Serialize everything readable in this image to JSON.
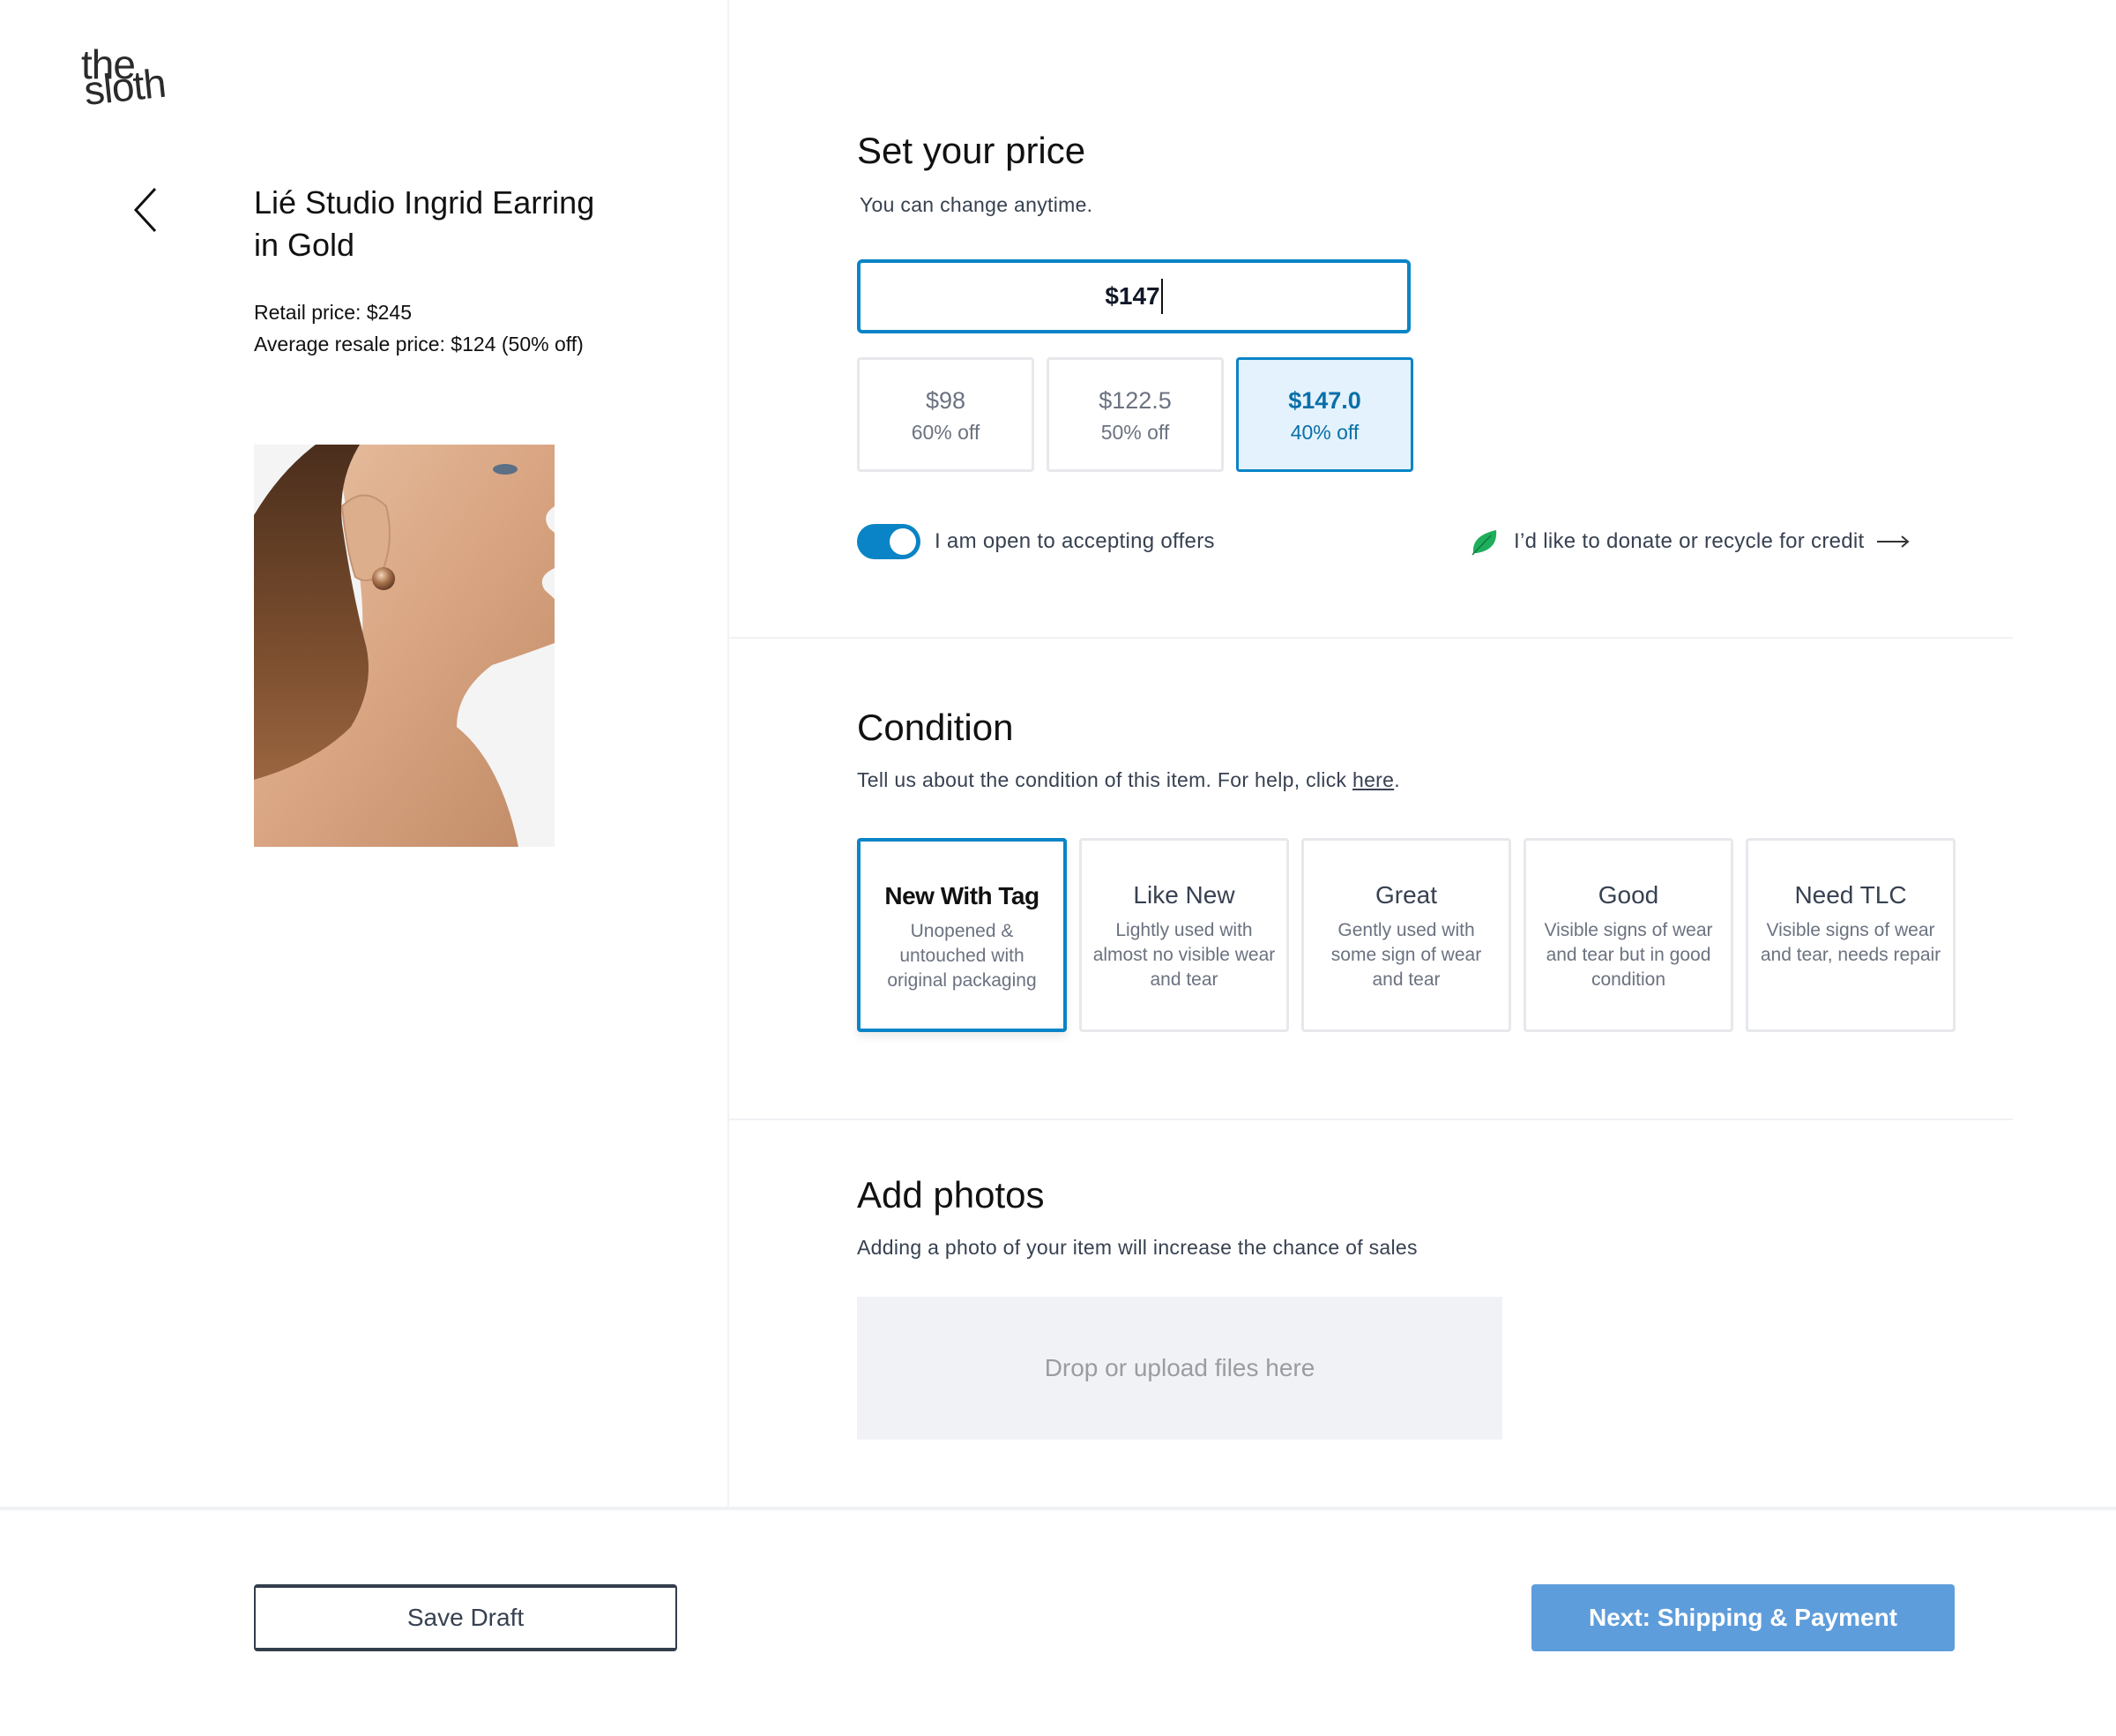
{
  "brand": {
    "logo_line1": "the",
    "logo_line2": "sloth"
  },
  "product": {
    "title": "Lié Studio Ingrid Earring in Gold",
    "retail_price": "Retail price: $245",
    "avg_resale_price": "Average resale price: $124 (50% off)",
    "image_alt": "Model wearing gold earring"
  },
  "price_section": {
    "title": "Set your price",
    "subtitle": "You can change anytime.",
    "input_value": "$147",
    "options": [
      {
        "value": "$98",
        "discount": "60% off",
        "selected": false
      },
      {
        "value": "$122.5",
        "discount": "50% off",
        "selected": false
      },
      {
        "value": "$147.0",
        "discount": "40% off",
        "selected": true
      }
    ],
    "offers_toggle": {
      "label": "I am open to accepting offers",
      "on": true
    },
    "donate_link": "I’d like to donate or recycle for credit"
  },
  "condition_section": {
    "title": "Condition",
    "subtitle_prefix": "Tell us about the condition of this item. For help, click ",
    "help_link": "here",
    "subtitle_suffix": ".",
    "options": [
      {
        "title": "New With Tag",
        "description": "Unopened & untouched with original packaging",
        "selected": true
      },
      {
        "title": "Like New",
        "description": "Lightly used with almost no visible wear and tear",
        "selected": false
      },
      {
        "title": "Great",
        "description": "Gently used with some sign of wear and tear",
        "selected": false
      },
      {
        "title": "Good",
        "description": "Visible signs of wear and tear but in good condition",
        "selected": false
      },
      {
        "title": "Need TLC",
        "description": "Visible signs of wear and tear, needs repair",
        "selected": false
      }
    ]
  },
  "photos_section": {
    "title": "Add photos",
    "subtitle": "Adding a photo of your item will increase the chance of sales",
    "dropzone_label": "Drop or upload files here"
  },
  "footer": {
    "save_label": "Save Draft",
    "next_label": "Next: Shipping & Payment"
  },
  "colors": {
    "accent": "#0a84c6",
    "accent_light": "#e3f2fc",
    "primary_button": "#5e9ddb",
    "leaf_green": "#1fae5c"
  }
}
